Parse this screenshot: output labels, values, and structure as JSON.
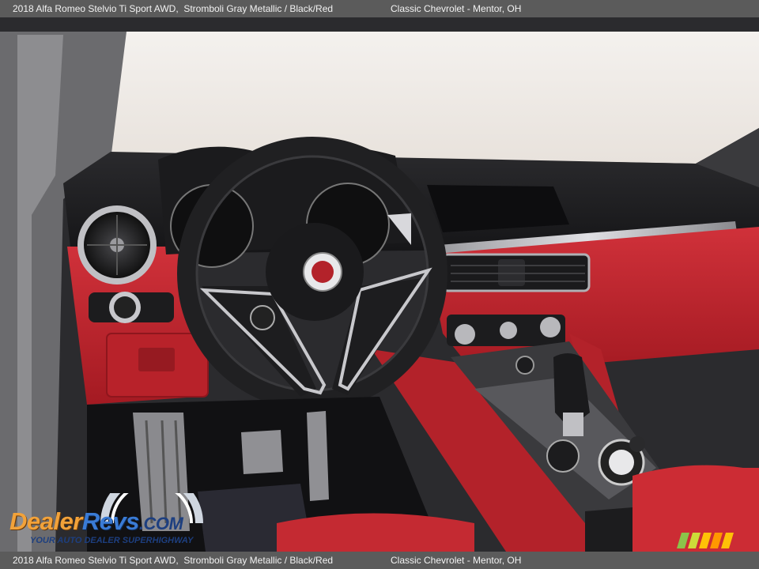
{
  "caption": {
    "vehicle": "2018 Alfa Romeo Stelvio Ti Sport AWD,",
    "color": "Stromboli Gray Metallic / Black/Red",
    "dealer": "Classic Chevrolet - Mentor, OH"
  },
  "watermark": {
    "logo_dealer": "Dealer",
    "logo_revs": "Revs",
    "logo_com": ".COM",
    "tagline": "YOUR AUTO DEALER SUPERHIGHWAY"
  },
  "colors": {
    "caption_bar": "#5b5b5b",
    "interior_red": "#c4232b",
    "dash_black": "#1c1c1e"
  }
}
